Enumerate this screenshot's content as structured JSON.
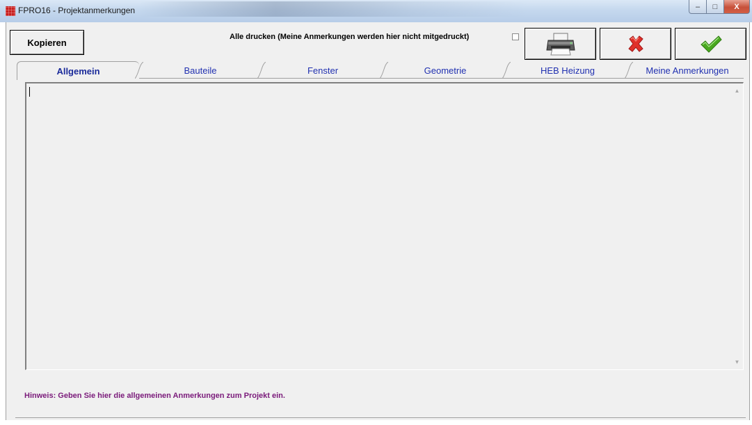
{
  "window": {
    "title": "FPRO16 - Projektanmerkungen",
    "min_glyph": "‒",
    "max_glyph": "□",
    "close_glyph": "X"
  },
  "toolbar": {
    "copy_label": "Kopieren",
    "print_all_label": "Alle drucken (Meine Anmerkungen werden hier nicht mitgedruckt)",
    "print_all_checked": false
  },
  "tabs": [
    {
      "label": "Allgemein",
      "active": true
    },
    {
      "label": "Bauteile",
      "active": false
    },
    {
      "label": "Fenster",
      "active": false
    },
    {
      "label": "Geometrie",
      "active": false
    },
    {
      "label": "HEB Heizung",
      "active": false
    },
    {
      "label": "Meine Anmerkungen",
      "active": false
    }
  ],
  "editor": {
    "value": ""
  },
  "hint": "Hinweis: Geben Sie hier die allgemeinen Anmerkungen zum Projekt ein.",
  "icons": {
    "print": "printer-icon",
    "cancel": "red-x-icon",
    "ok": "green-check-icon"
  },
  "colors": {
    "tab_text": "#2030b0",
    "hint_text": "#7a1a7a",
    "cancel_red": "#e0302a",
    "ok_green": "#4aa820"
  }
}
